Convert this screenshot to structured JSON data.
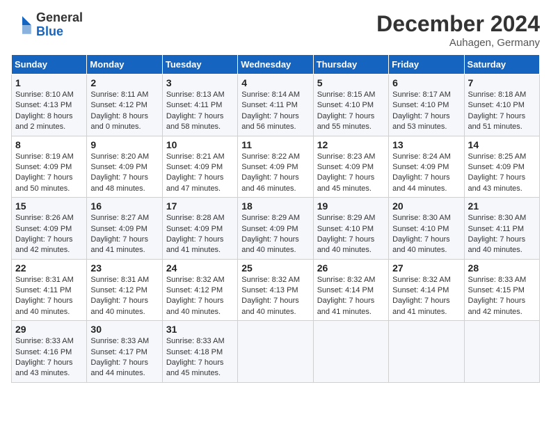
{
  "header": {
    "logo_general": "General",
    "logo_blue": "Blue",
    "month_title": "December 2024",
    "location": "Auhagen, Germany"
  },
  "days_of_week": [
    "Sunday",
    "Monday",
    "Tuesday",
    "Wednesday",
    "Thursday",
    "Friday",
    "Saturday"
  ],
  "weeks": [
    [
      {
        "day": "1",
        "sunrise": "8:10 AM",
        "sunset": "4:13 PM",
        "daylight": "8 hours and 2 minutes."
      },
      {
        "day": "2",
        "sunrise": "8:11 AM",
        "sunset": "4:12 PM",
        "daylight": "8 hours and 0 minutes."
      },
      {
        "day": "3",
        "sunrise": "8:13 AM",
        "sunset": "4:11 PM",
        "daylight": "7 hours and 58 minutes."
      },
      {
        "day": "4",
        "sunrise": "8:14 AM",
        "sunset": "4:11 PM",
        "daylight": "7 hours and 56 minutes."
      },
      {
        "day": "5",
        "sunrise": "8:15 AM",
        "sunset": "4:10 PM",
        "daylight": "7 hours and 55 minutes."
      },
      {
        "day": "6",
        "sunrise": "8:17 AM",
        "sunset": "4:10 PM",
        "daylight": "7 hours and 53 minutes."
      },
      {
        "day": "7",
        "sunrise": "8:18 AM",
        "sunset": "4:10 PM",
        "daylight": "7 hours and 51 minutes."
      }
    ],
    [
      {
        "day": "8",
        "sunrise": "8:19 AM",
        "sunset": "4:09 PM",
        "daylight": "7 hours and 50 minutes."
      },
      {
        "day": "9",
        "sunrise": "8:20 AM",
        "sunset": "4:09 PM",
        "daylight": "7 hours and 48 minutes."
      },
      {
        "day": "10",
        "sunrise": "8:21 AM",
        "sunset": "4:09 PM",
        "daylight": "7 hours and 47 minutes."
      },
      {
        "day": "11",
        "sunrise": "8:22 AM",
        "sunset": "4:09 PM",
        "daylight": "7 hours and 46 minutes."
      },
      {
        "day": "12",
        "sunrise": "8:23 AM",
        "sunset": "4:09 PM",
        "daylight": "7 hours and 45 minutes."
      },
      {
        "day": "13",
        "sunrise": "8:24 AM",
        "sunset": "4:09 PM",
        "daylight": "7 hours and 44 minutes."
      },
      {
        "day": "14",
        "sunrise": "8:25 AM",
        "sunset": "4:09 PM",
        "daylight": "7 hours and 43 minutes."
      }
    ],
    [
      {
        "day": "15",
        "sunrise": "8:26 AM",
        "sunset": "4:09 PM",
        "daylight": "7 hours and 42 minutes."
      },
      {
        "day": "16",
        "sunrise": "8:27 AM",
        "sunset": "4:09 PM",
        "daylight": "7 hours and 41 minutes."
      },
      {
        "day": "17",
        "sunrise": "8:28 AM",
        "sunset": "4:09 PM",
        "daylight": "7 hours and 41 minutes."
      },
      {
        "day": "18",
        "sunrise": "8:29 AM",
        "sunset": "4:09 PM",
        "daylight": "7 hours and 40 minutes."
      },
      {
        "day": "19",
        "sunrise": "8:29 AM",
        "sunset": "4:10 PM",
        "daylight": "7 hours and 40 minutes."
      },
      {
        "day": "20",
        "sunrise": "8:30 AM",
        "sunset": "4:10 PM",
        "daylight": "7 hours and 40 minutes."
      },
      {
        "day": "21",
        "sunrise": "8:30 AM",
        "sunset": "4:11 PM",
        "daylight": "7 hours and 40 minutes."
      }
    ],
    [
      {
        "day": "22",
        "sunrise": "8:31 AM",
        "sunset": "4:11 PM",
        "daylight": "7 hours and 40 minutes."
      },
      {
        "day": "23",
        "sunrise": "8:31 AM",
        "sunset": "4:12 PM",
        "daylight": "7 hours and 40 minutes."
      },
      {
        "day": "24",
        "sunrise": "8:32 AM",
        "sunset": "4:12 PM",
        "daylight": "7 hours and 40 minutes."
      },
      {
        "day": "25",
        "sunrise": "8:32 AM",
        "sunset": "4:13 PM",
        "daylight": "7 hours and 40 minutes."
      },
      {
        "day": "26",
        "sunrise": "8:32 AM",
        "sunset": "4:14 PM",
        "daylight": "7 hours and 41 minutes."
      },
      {
        "day": "27",
        "sunrise": "8:32 AM",
        "sunset": "4:14 PM",
        "daylight": "7 hours and 41 minutes."
      },
      {
        "day": "28",
        "sunrise": "8:33 AM",
        "sunset": "4:15 PM",
        "daylight": "7 hours and 42 minutes."
      }
    ],
    [
      {
        "day": "29",
        "sunrise": "8:33 AM",
        "sunset": "4:16 PM",
        "daylight": "7 hours and 43 minutes."
      },
      {
        "day": "30",
        "sunrise": "8:33 AM",
        "sunset": "4:17 PM",
        "daylight": "7 hours and 44 minutes."
      },
      {
        "day": "31",
        "sunrise": "8:33 AM",
        "sunset": "4:18 PM",
        "daylight": "7 hours and 45 minutes."
      },
      null,
      null,
      null,
      null
    ]
  ],
  "labels": {
    "sunrise": "Sunrise:",
    "sunset": "Sunset:",
    "daylight": "Daylight hours"
  }
}
